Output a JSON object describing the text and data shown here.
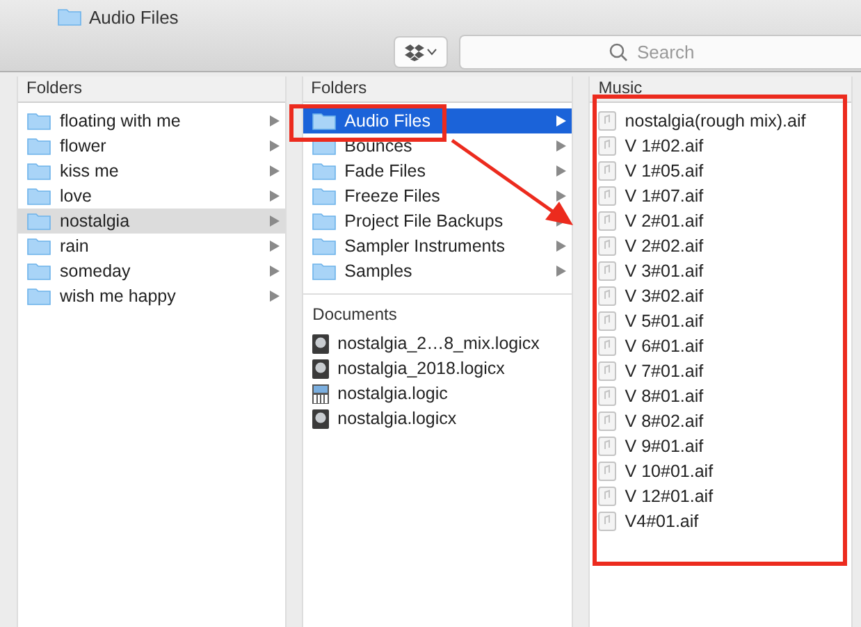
{
  "window": {
    "title": "Audio Files"
  },
  "toolbar": {
    "search": {
      "placeholder": "Search"
    }
  },
  "columns": [
    {
      "header": "Folders",
      "items": [
        {
          "name": "floating with me",
          "selected": false
        },
        {
          "name": "flower",
          "selected": false
        },
        {
          "name": "kiss me",
          "selected": false
        },
        {
          "name": "love",
          "selected": false
        },
        {
          "name": "nostalgia",
          "selected": true
        },
        {
          "name": "rain",
          "selected": false
        },
        {
          "name": "someday",
          "selected": false
        },
        {
          "name": "wish me happy",
          "selected": false
        }
      ]
    },
    {
      "header": "Folders",
      "items": [
        {
          "name": "Audio Files",
          "selected": true
        },
        {
          "name": "Bounces",
          "selected": false
        },
        {
          "name": "Fade Files",
          "selected": false
        },
        {
          "name": "Freeze Files",
          "selected": false
        },
        {
          "name": "Project File Backups",
          "selected": false
        },
        {
          "name": "Sampler Instruments",
          "selected": false
        },
        {
          "name": "Samples",
          "selected": false
        }
      ],
      "documents": {
        "header": "Documents",
        "items": [
          {
            "name": "nostalgia_2…8_mix.logicx",
            "kind": "project"
          },
          {
            "name": "nostalgia_2018.logicx",
            "kind": "project"
          },
          {
            "name": "nostalgia.logic",
            "kind": "legacy"
          },
          {
            "name": "nostalgia.logicx",
            "kind": "project"
          }
        ]
      }
    },
    {
      "header": "Music",
      "files": [
        "nostalgia(rough mix).aif",
        "V 1#02.aif",
        "V 1#05.aif",
        "V 1#07.aif",
        "V 2#01.aif",
        "V 2#02.aif",
        "V 3#01.aif",
        "V 3#02.aif",
        "V 5#01.aif",
        "V 6#01.aif",
        "V 7#01.aif",
        "V 8#01.aif",
        "V 8#02.aif",
        "V 9#01.aif",
        "V 10#01.aif",
        "V 12#01.aif",
        "V4#01.aif"
      ]
    }
  ]
}
